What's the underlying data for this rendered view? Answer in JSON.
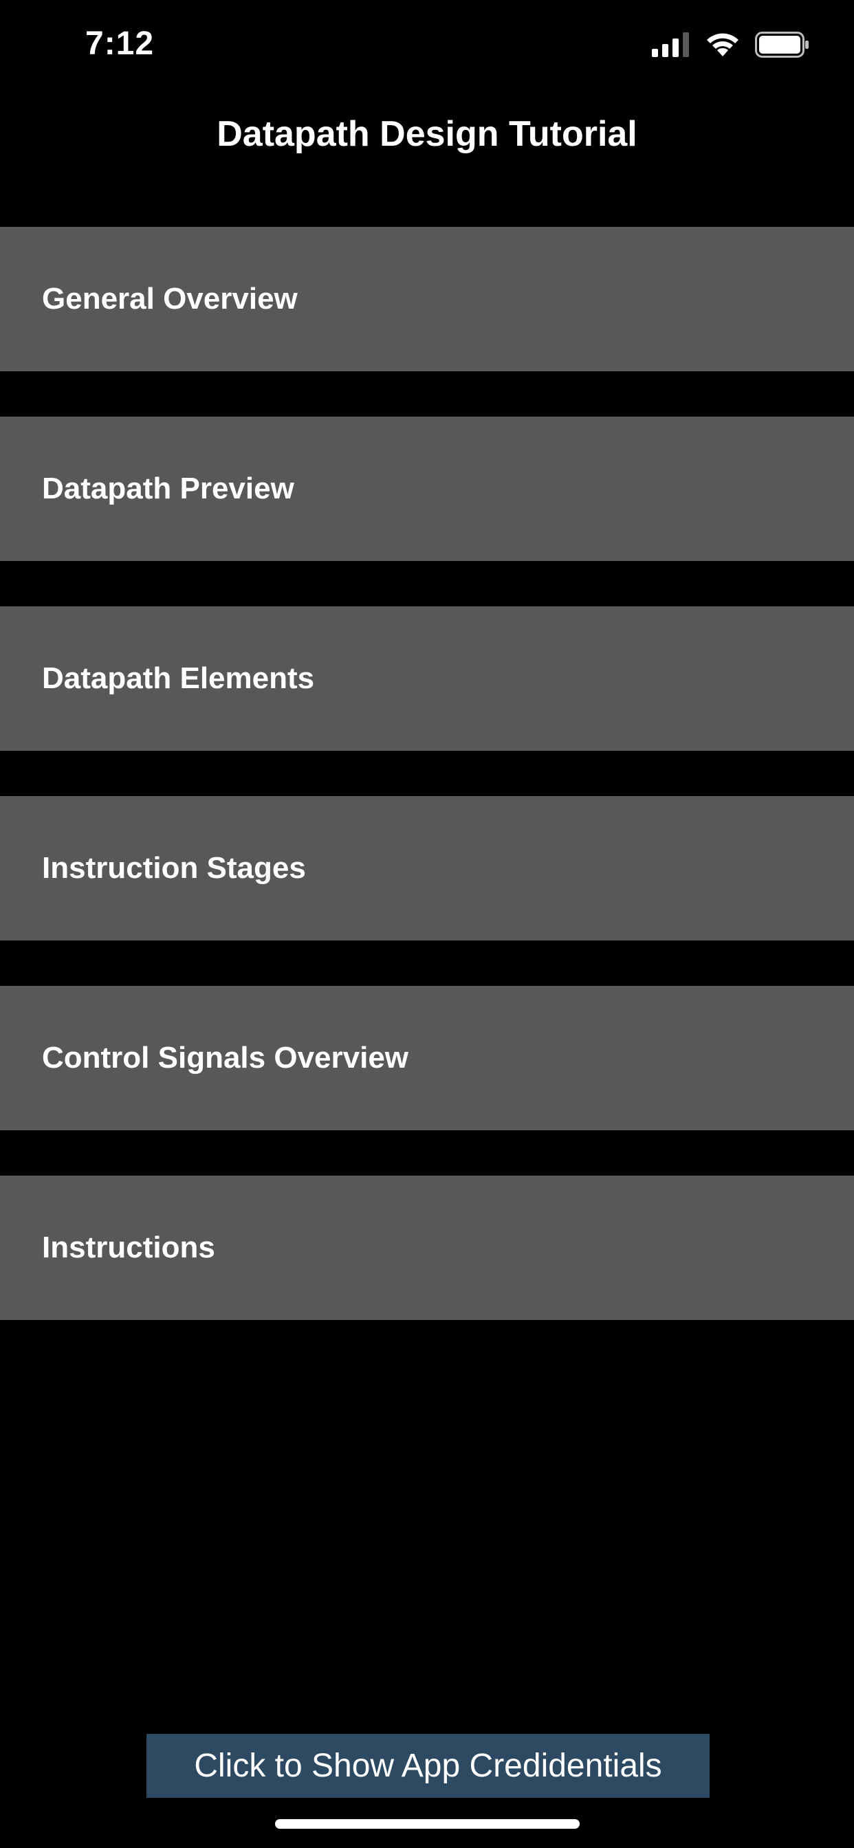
{
  "status_bar": {
    "time": "7:12",
    "icons": [
      "cellular-signal-icon",
      "wifi-icon",
      "battery-icon"
    ]
  },
  "nav": {
    "title": "Datapath Design Tutorial"
  },
  "menu": {
    "items": [
      {
        "label": "General Overview"
      },
      {
        "label": "Datapath Preview"
      },
      {
        "label": "Datapath Elements"
      },
      {
        "label": "Instruction Stages"
      },
      {
        "label": "Control Signals Overview"
      },
      {
        "label": "Instructions"
      }
    ]
  },
  "footer": {
    "credentials_label": "Click to Show App Credidentials"
  },
  "colors": {
    "background": "#000000",
    "menu_item_bg": "#585858",
    "button_bg": "#2e4a62",
    "text": "#ffffff"
  }
}
